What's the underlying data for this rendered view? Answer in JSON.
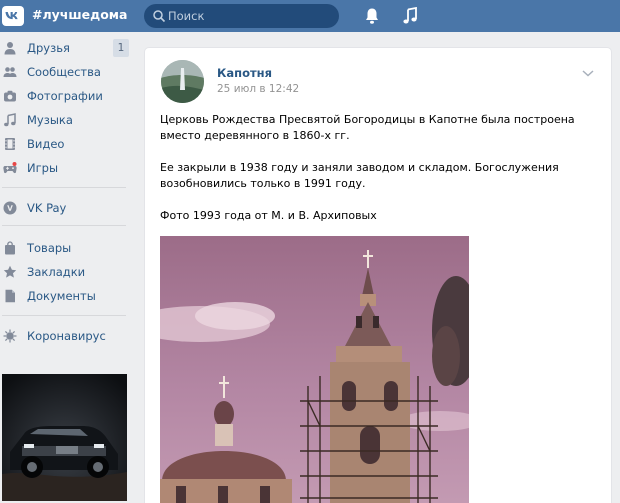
{
  "header": {
    "hashtag": "#лучшедома",
    "search_placeholder": "Поиск",
    "icons": [
      "vk-logo",
      "bell-icon",
      "music-icon"
    ],
    "colors": {
      "bar": "#4a76a8",
      "search": "#224b7a"
    }
  },
  "sidebar": {
    "items": [
      {
        "label": "Друзья",
        "icon": "user-icon",
        "badge": "1"
      },
      {
        "label": "Сообщества",
        "icon": "users-icon"
      },
      {
        "label": "Фотографии",
        "icon": "camera-icon"
      },
      {
        "label": "Музыка",
        "icon": "music-note-icon"
      },
      {
        "label": "Видео",
        "icon": "film-icon"
      },
      {
        "label": "Игры",
        "icon": "gamepad-icon"
      },
      {
        "label": "VK Pay",
        "icon": "vkpay-icon"
      },
      {
        "label": "Товары",
        "icon": "bag-icon"
      },
      {
        "label": "Закладки",
        "icon": "star-icon"
      },
      {
        "label": "Документы",
        "icon": "document-icon"
      },
      {
        "label": "Коронавирус",
        "icon": "virus-icon"
      }
    ]
  },
  "post": {
    "author": "Капотня",
    "date": "25 июл в 12:42",
    "paragraphs": [
      "Церковь Рождества Пресвятой Богородицы в Капотне была построена вместо деревянного в 1860-х гг.",
      "Ее закрыли в 1938 году и заняли заводом и складом. Богослужения возобновились только в 1991 году.",
      "Фото 1993 года от М. и В. Архиповых"
    ]
  },
  "colors": {
    "link": "#2a5885",
    "background": "#edeef0",
    "muted": "#939393"
  }
}
